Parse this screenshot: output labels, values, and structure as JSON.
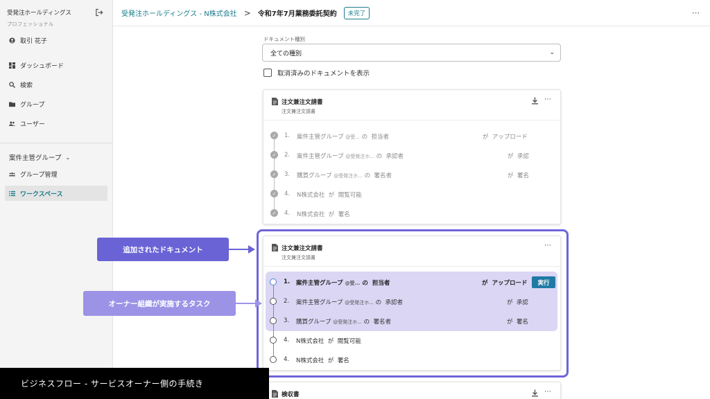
{
  "sidebar": {
    "org_name": "受発注ホールディングス",
    "org_plan": "プロフェッショナル",
    "user_name": "取引 花子",
    "nav": [
      {
        "label": "ダッシュボード",
        "icon": "dashboard-icon"
      },
      {
        "label": "検索",
        "icon": "search-icon"
      },
      {
        "label": "グループ",
        "icon": "folder-icon"
      },
      {
        "label": "ユーザー",
        "icon": "users-icon"
      }
    ],
    "group_section": "案件主管グループ",
    "group_items": [
      {
        "label": "グループ管理",
        "icon": "group-manage-icon"
      },
      {
        "label": "ワークスペース",
        "icon": "list-icon",
        "active": true
      }
    ]
  },
  "header": {
    "breadcrumb_parent": "受発注ホールディングス - N株式会社",
    "separator": ">",
    "breadcrumb_current": "令和7年7月業務委託契約",
    "status": "未完了",
    "more": "⋯"
  },
  "filter": {
    "label": "ドキュメント種別",
    "select_value": "全ての種別",
    "checkbox_label": "取消済みのドキュメントを表示"
  },
  "card1": {
    "title": "注文兼注文請書",
    "subtitle": "注文兼注文請書",
    "tasks": [
      {
        "num": "1.",
        "group": "案件主管グループ",
        "handle": "@受...",
        "no": "の",
        "role": "担当者",
        "ga": "が",
        "action": "アップロード"
      },
      {
        "num": "2.",
        "group": "案件主管グループ",
        "handle": "@受発注ホ...",
        "no": "の",
        "role": "承認者",
        "ga": "が",
        "action": "承認"
      },
      {
        "num": "3.",
        "group": "購買グループ",
        "handle": "@受発注ホ...",
        "no": "の",
        "role": "署名者",
        "ga": "が",
        "action": "署名"
      },
      {
        "num": "4.",
        "group": "N株式会社",
        "ga": "が",
        "action": "閲覧可能"
      },
      {
        "num": "4.",
        "group": "N株式会社",
        "ga": "が",
        "action": "署名"
      }
    ]
  },
  "card2": {
    "title": "注文兼注文請書",
    "subtitle": "注文兼注文請書",
    "run_label": "実行",
    "tasks": [
      {
        "num": "1.",
        "group": "案件主管グループ",
        "handle": "@受...",
        "no": "の",
        "role": "担当者",
        "ga": "が",
        "action": "アップロード"
      },
      {
        "num": "2.",
        "group": "案件主管グループ",
        "handle": "@受発注ホ...",
        "no": "の",
        "role": "承認者",
        "ga": "が",
        "action": "承認"
      },
      {
        "num": "3.",
        "group": "購買グループ",
        "handle": "@受発注ホ...",
        "no": "の",
        "role": "署名者",
        "ga": "が",
        "action": "署名"
      },
      {
        "num": "4.",
        "group": "N株式会社",
        "ga": "が",
        "action": "閲覧可能"
      },
      {
        "num": "4.",
        "group": "N株式会社",
        "ga": "が",
        "action": "署名"
      }
    ]
  },
  "card3": {
    "title": "検収書"
  },
  "annotations": {
    "added_document": "追加されたドキュメント",
    "owner_tasks": "オーナー組織が実施するタスク",
    "banner": "ビジネスフロー - サービスオーナー側の手続き"
  },
  "colors": {
    "accent": "#1a7c8c",
    "run_button": "#1f7aa5",
    "callout_dark": "#6a63d5",
    "callout_light": "#9c93e6",
    "highlight": "#dad6f4"
  }
}
